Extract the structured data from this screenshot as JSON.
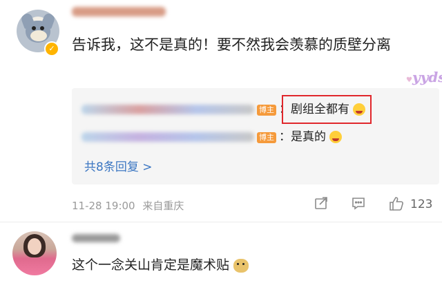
{
  "comment": {
    "text": "告诉我，这不是真的！要不然我会羡慕的质壁分离",
    "time": "11-28 19:00",
    "location": "来自重庆",
    "like_count": "123",
    "sticker": "yyds"
  },
  "replies": {
    "items": [
      {
        "badge": "博主",
        "text": "：剧组全都有"
      },
      {
        "badge": "博主",
        "text": "：是真的"
      }
    ],
    "more_label": "共8条回复 >"
  },
  "second_comment": {
    "text": "这个一念关山肯定是魔术贴"
  },
  "colors": {
    "link": "#3b76c2",
    "badge": "#f59a3b",
    "highlight": "#e0262b",
    "verified": "#ffb400"
  },
  "icons": [
    "verified-icon",
    "share-icon",
    "comment-icon",
    "like-icon",
    "emoji-icon",
    "doge-emoji-icon"
  ]
}
